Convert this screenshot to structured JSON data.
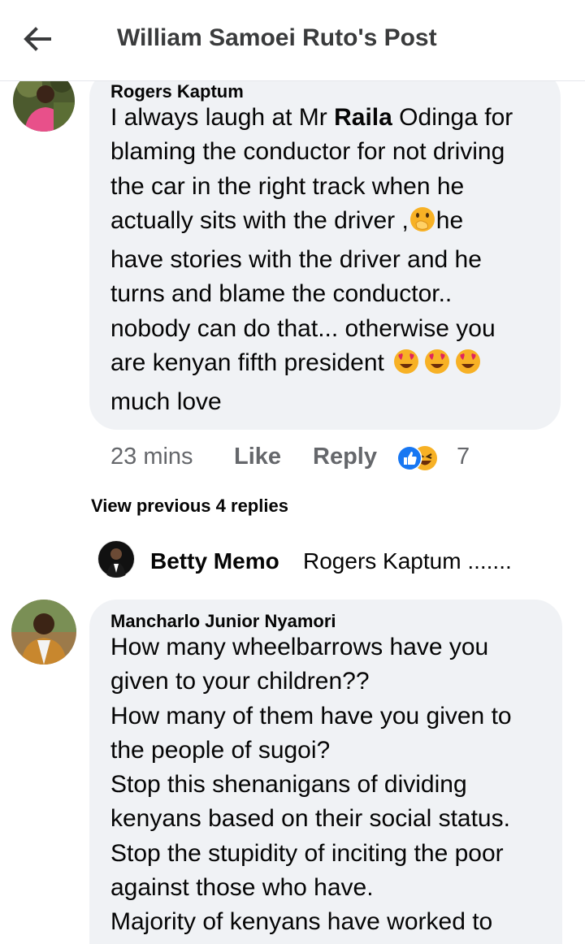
{
  "header": {
    "title": "William Samoei Ruto's Post"
  },
  "comment1": {
    "author": "Rogers Kaptum",
    "lines": [
      {
        "before": "I always laugh at Mr ",
        "bold": "Raila",
        "after": " Odinga for"
      },
      {
        "text": "blaming the conductor for not driving"
      },
      {
        "text": "the car in the right track when he"
      },
      {
        "before": "actually sits with the driver ,",
        "emoji": "face-with-hand-over-mouth",
        "after": "he"
      },
      {
        "text": "have stories with the driver and he"
      },
      {
        "text": "turns and blame the conductor.."
      },
      {
        "text": "nobody can do that... otherwise you"
      },
      {
        "text": "are kenyan fifth president ",
        "emojis": [
          "heart-eyes",
          "heart-eyes",
          "heart-eyes"
        ]
      },
      {
        "text": "much love"
      }
    ],
    "time": "23 mins",
    "like_label": "Like",
    "reply_label": "Reply",
    "reaction_count": "7",
    "reaction_icons": [
      "like-reaction-icon",
      "haha-reaction-icon"
    ]
  },
  "view_previous": "View previous 4 replies",
  "reply_preview": {
    "name": "Betty Memo",
    "text": "Rogers Kaptum ......."
  },
  "comment2": {
    "author": "Mancharlo Junior Nyamori",
    "lines": [
      "How many wheelbarrows have you",
      "given to your children??",
      "How many of them have you given to",
      "the people of sugoi?",
      "Stop this shenanigans of dividing",
      "kenyans based on their social status.",
      "Stop the stupidity of inciting the poor",
      "against those who have.",
      "Majority of kenyans have worked to"
    ]
  },
  "colors": {
    "bubble": "#f0f2f5",
    "meta_text": "#65676b",
    "like_blue": "#1877f2",
    "haha_yellow": "#f7b125"
  }
}
